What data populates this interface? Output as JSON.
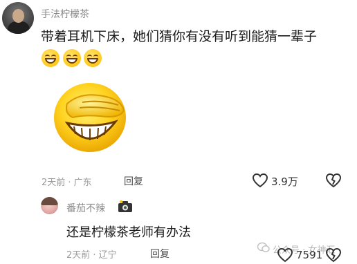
{
  "comment1": {
    "username": "手法柠檬茶",
    "text": "带着耳机下床，她们猜你有没有听到能猜一辈子",
    "emojis": [
      "grinning-face-emoji",
      "grinning-face-emoji",
      "grinning-face-emoji"
    ],
    "sticker": "laughing-face-sticker",
    "time_location": "2天前 · 广东",
    "reply_label": "回复",
    "like_count": "3.9万"
  },
  "reply1": {
    "username": "番茄不辣",
    "badge_icon": "camera-icon",
    "text": "还是柠檬茶老师有办法",
    "time_location": "2天前 · 辽宁",
    "reply_label": "回复",
    "like_count": "7591"
  },
  "watermark": {
    "text": "公众号 · 女神汇"
  }
}
